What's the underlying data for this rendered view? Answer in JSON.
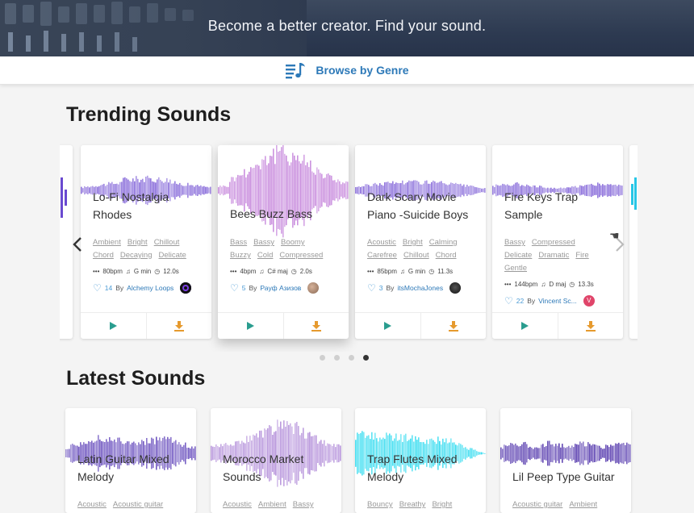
{
  "hero": {
    "title": "Become a better creator. Find your sound."
  },
  "genre_bar": {
    "label": "Browse by Genre"
  },
  "trending": {
    "title": "Trending Sounds",
    "cards": [
      {
        "title": "Lo-Fi Nostalgia Rhodes",
        "tags": [
          "Ambient",
          "Bright",
          "Chillout",
          "Chord",
          "Decaying",
          "Delicate"
        ],
        "bpm": "80bpm",
        "key": "G min",
        "duration": "12.0s",
        "likes": "14",
        "by": "By",
        "author": "Alchemy Loops",
        "wave_color": "#7b5bd6"
      },
      {
        "title": "Bees Buzz Bass",
        "tags": [
          "Bass",
          "Bassy",
          "Boomy",
          "Buzzy",
          "Cold",
          "Compressed"
        ],
        "bpm": "4bpm",
        "key": "C# maj",
        "duration": "2.0s",
        "likes": "5",
        "by": "By",
        "author": "Рауф Азизов",
        "wave_color": "#c07ad8"
      },
      {
        "title": "Dark Scary Movie Piano -Suicide Boys",
        "tags": [
          "Acoustic",
          "Bright",
          "Calming",
          "Carefree",
          "Chillout",
          "Chord"
        ],
        "bpm": "85bpm",
        "key": "G min",
        "duration": "11.3s",
        "likes": "3",
        "by": "By",
        "author": "itsMochaJones",
        "wave_color": "#7b5bd6"
      },
      {
        "title": "Fire Keys Trap Sample",
        "tags": [
          "Bassy",
          "Compressed",
          "Delicate",
          "Dramatic",
          "Fire",
          "Gentle"
        ],
        "bpm": "144bpm",
        "key": "D maj",
        "duration": "13.3s",
        "likes": "22",
        "by": "By",
        "author": "Vincent Sc...",
        "wave_color": "#7b5bd6"
      }
    ],
    "carousel_dots": 4,
    "active_dot": 4
  },
  "latest": {
    "title": "Latest Sounds",
    "cards": [
      {
        "title": "Latin Guitar Mixed Melody",
        "tags": [
          "Acoustic",
          "Acoustic guitar"
        ],
        "wave_color": "#5c3fb8"
      },
      {
        "title": "Morocco Market Sounds",
        "tags": [
          "Acoustic",
          "Ambient",
          "Bassy"
        ],
        "wave_color": "#b08ad8"
      },
      {
        "title": "Trap Flutes Mixed Melody",
        "tags": [
          "Bouncy",
          "Breathy",
          "Bright"
        ],
        "wave_color": "#1fd8ee"
      },
      {
        "title": "Lil Peep Type Guitar",
        "tags": [
          "Acoustic guitar",
          "Ambient"
        ],
        "wave_color": "#4a2ca8"
      }
    ]
  },
  "colors": {
    "accent_blue": "#2d79b8",
    "play_green": "#2a9d8f",
    "download_orange": "#e69a2e",
    "heart_blue": "#4a9ad4"
  }
}
